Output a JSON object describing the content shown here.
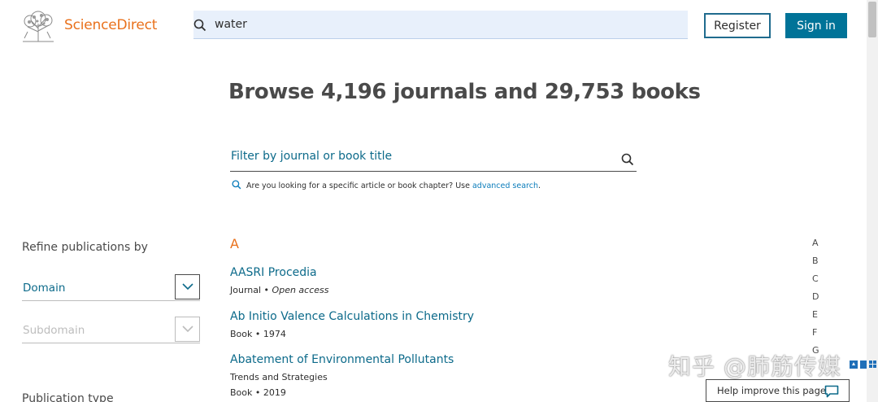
{
  "header": {
    "brand": "ScienceDirect",
    "search_query": "water",
    "register_label": "Register",
    "signin_label": "Sign in"
  },
  "main": {
    "headline": "Browse 4,196 journals and 29,753 books",
    "filter_placeholder": "Filter by journal or book title",
    "hint_text": "Are you looking for a specific article or book chapter? Use ",
    "hint_link": "advanced search",
    "hint_end": "."
  },
  "sidebar": {
    "refine_title": "Refine publications by",
    "domain_label": "Domain",
    "subdomain_label": "Subdomain",
    "publication_type_title": "Publication type"
  },
  "list": {
    "letter": "A",
    "items": [
      {
        "title": "AASRI Procedia",
        "meta1": "Journal",
        "sep": "•",
        "meta2": "Open access"
      },
      {
        "title": "Ab Initio Valence Calculations in Chemistry",
        "meta1": "Book",
        "sep": "•",
        "meta2": "1974"
      },
      {
        "title": "Abatement of Environmental Pollutants",
        "subtitle": "Trends and Strategies",
        "meta1": "Book",
        "sep": "•",
        "meta2": "2019"
      }
    ]
  },
  "alphabet": [
    "A",
    "B",
    "C",
    "D",
    "E",
    "F",
    "G"
  ],
  "overlay": {
    "watermark": "知乎 @肺筋传媒",
    "help_label": "Help improve this page"
  },
  "colors": {
    "brand_orange": "#e9711c",
    "link_teal": "#0c6a8a",
    "signin_bg": "#007398",
    "search_bg": "#e8f0fb"
  },
  "icons": {
    "logo": "elsevier-tree-logo",
    "search": "search-icon",
    "chevron": "chevron-down-icon",
    "feedback": "speech-bubble-icon"
  }
}
